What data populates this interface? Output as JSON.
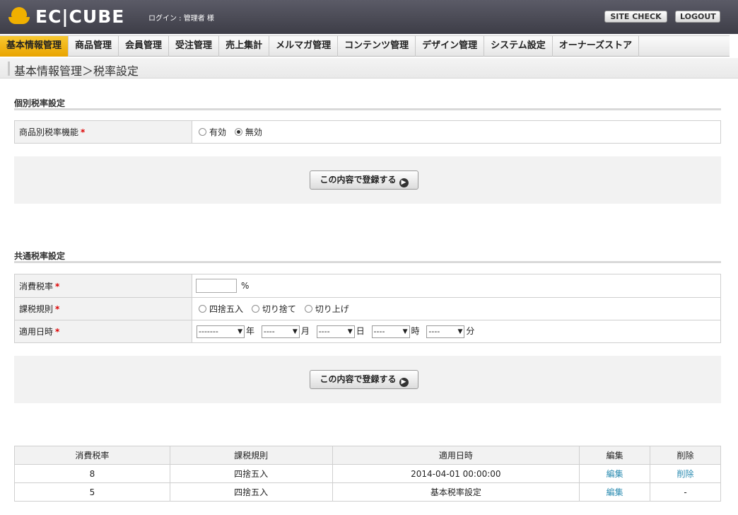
{
  "header": {
    "logo_text": "EC|CUBE",
    "login_info": "ログイン : 管理者 様",
    "site_check_label": "SITE CHECK",
    "logout_label": "LOGOUT"
  },
  "nav": {
    "items": [
      {
        "label": "基本情報管理"
      },
      {
        "label": "商品管理"
      },
      {
        "label": "会員管理"
      },
      {
        "label": "受注管理"
      },
      {
        "label": "売上集計"
      },
      {
        "label": "メルマガ管理"
      },
      {
        "label": "コンテンツ管理"
      },
      {
        "label": "デザイン管理"
      },
      {
        "label": "システム設定"
      },
      {
        "label": "オーナーズストア"
      }
    ],
    "active": "基本情報管理"
  },
  "breadcrumb": "基本情報管理＞税率設定",
  "individual": {
    "title": "個別税率設定",
    "row_label": "商品別税率機能",
    "required_mark": "*",
    "options": [
      "有効",
      "無効"
    ],
    "selected": "無効",
    "submit_label": "この内容で登録する"
  },
  "common": {
    "title": "共通税率設定",
    "rate_label": "消費税率",
    "rate_value": "",
    "rate_unit": "%",
    "rule_label": "課税規則",
    "rule_options": [
      "四捨五入",
      "切り捨て",
      "切り上げ"
    ],
    "date_label": "適用日時",
    "date_selects": [
      {
        "value": "-------",
        "unit": "年"
      },
      {
        "value": "----",
        "unit": "月"
      },
      {
        "value": "----",
        "unit": "日"
      },
      {
        "value": "----",
        "unit": "時"
      },
      {
        "value": "----",
        "unit": "分"
      }
    ],
    "required_mark": "*",
    "submit_label": "この内容で登録する"
  },
  "list": {
    "headers": [
      "消費税率",
      "課税規則",
      "適用日時",
      "編集",
      "削除"
    ],
    "rows": [
      {
        "rate": "8",
        "rule": "四捨五入",
        "date": "2014-04-01 00:00:00",
        "edit": "編集",
        "delete": "削除"
      },
      {
        "rate": "5",
        "rule": "四捨五入",
        "date": "基本税率設定",
        "edit": "編集",
        "delete": "-"
      }
    ]
  },
  "colors": {
    "header_bg": "#4a4a55",
    "nav_active": "#f0b400",
    "link": "#2a8bb0",
    "required": "#dd0000"
  }
}
